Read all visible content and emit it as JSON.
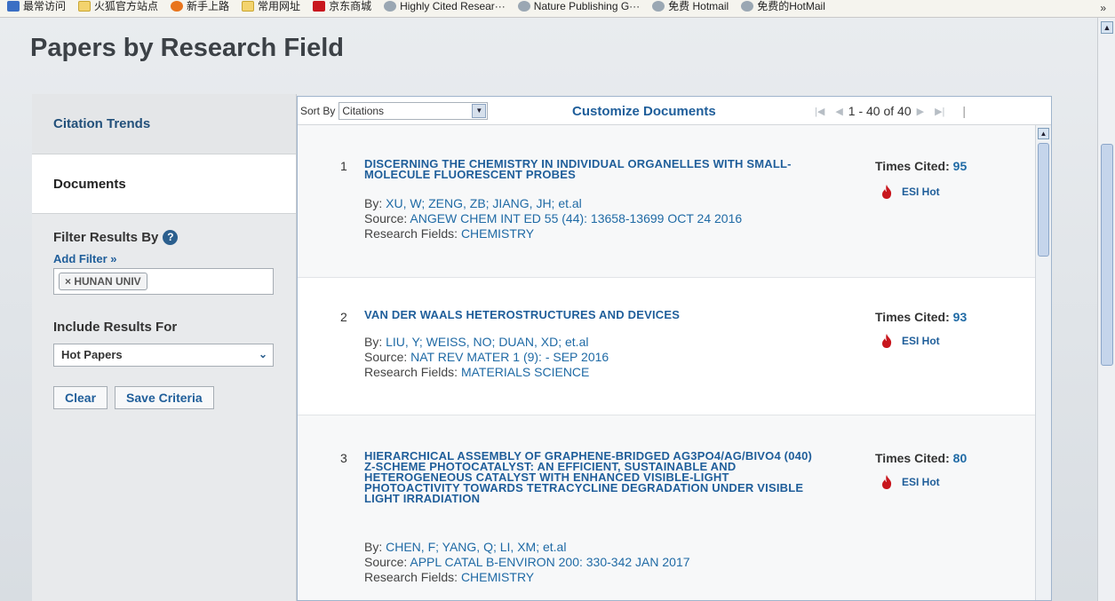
{
  "bookmarks": {
    "items": [
      {
        "label": "最常访问",
        "icon": "search-icon"
      },
      {
        "label": "火狐官方站点",
        "icon": "folder-icon"
      },
      {
        "label": "新手上路",
        "icon": "firefox-icon"
      },
      {
        "label": "常用网址",
        "icon": "folder-icon"
      },
      {
        "label": "京东商城",
        "icon": "jd-icon"
      },
      {
        "label": "Highly Cited Resear···",
        "icon": "globe-icon"
      },
      {
        "label": "Nature Publishing G···",
        "icon": "globe-icon"
      },
      {
        "label": "免费 Hotmail",
        "icon": "globe-icon"
      },
      {
        "label": "免费的HotMail",
        "icon": "globe-icon"
      }
    ],
    "more": "»"
  },
  "page": {
    "title": "Papers by Research Field"
  },
  "sidebar": {
    "nav": [
      {
        "label": "Citation Trends"
      },
      {
        "label": "Documents"
      }
    ],
    "filter_title": "Filter Results By",
    "help": "?",
    "add_filter": "Add Filter »",
    "filter_chip": "× HUNAN UNIV",
    "include_title": "Include Results For",
    "include_value": "Hot Papers",
    "buttons": {
      "clear": "Clear",
      "save": "Save Criteria"
    }
  },
  "toolbar": {
    "sort_label": "Sort By",
    "sort_value": "Citations",
    "customize": "Customize Documents",
    "range": "1 - 40 of 40"
  },
  "records": [
    {
      "num": "1",
      "title": "DISCERNING THE CHEMISTRY IN INDIVIDUAL ORGANELLES WITH SMALL-MOLECULE FLUORESCENT PROBES",
      "by_label": "By:",
      "authors": "XU, W;  ZENG, ZB;  JIANG, JH;  et.al",
      "source_label": "Source:",
      "source": "ANGEW CHEM INT ED 55 (44): 13658-13699 OCT 24 2016",
      "fields_label": "Research Fields:",
      "fields": "CHEMISTRY",
      "cited_label": "Times Cited:",
      "cited": "95",
      "badge": "ESI Hot"
    },
    {
      "num": "2",
      "title": "VAN DER WAALS HETEROSTRUCTURES AND DEVICES",
      "by_label": "By:",
      "authors": "LIU, Y;  WEISS, NO;  DUAN, XD;  et.al",
      "source_label": "Source:",
      "source": "NAT REV MATER 1 (9): - SEP 2016",
      "fields_label": "Research Fields:",
      "fields": "MATERIALS SCIENCE",
      "cited_label": "Times Cited:",
      "cited": "93",
      "badge": "ESI Hot"
    },
    {
      "num": "3",
      "title": "HIERARCHICAL ASSEMBLY OF GRAPHENE-BRIDGED AG3PO4/AG/BIVO4 (040) Z-SCHEME PHOTOCATALYST: AN EFFICIENT, SUSTAINABLE AND HETEROGENEOUS CATALYST WITH ENHANCED VISIBLE-LIGHT PHOTOACTIVITY TOWARDS TETRACYCLINE DEGRADATION UNDER VISIBLE LIGHT IRRADIATION",
      "by_label": "By:",
      "authors": "CHEN, F;  YANG, Q;  LI, XM;  et.al",
      "source_label": "Source:",
      "source": "APPL CATAL B-ENVIRON 200: 330-342 JAN 2017",
      "fields_label": "Research Fields:",
      "fields": "CHEMISTRY",
      "cited_label": "Times Cited:",
      "cited": "80",
      "badge": "ESI Hot"
    }
  ],
  "colors": {
    "link": "#1f5e9a",
    "accent_fire": "#c8161d",
    "panel_border": "#9fb4cc"
  }
}
